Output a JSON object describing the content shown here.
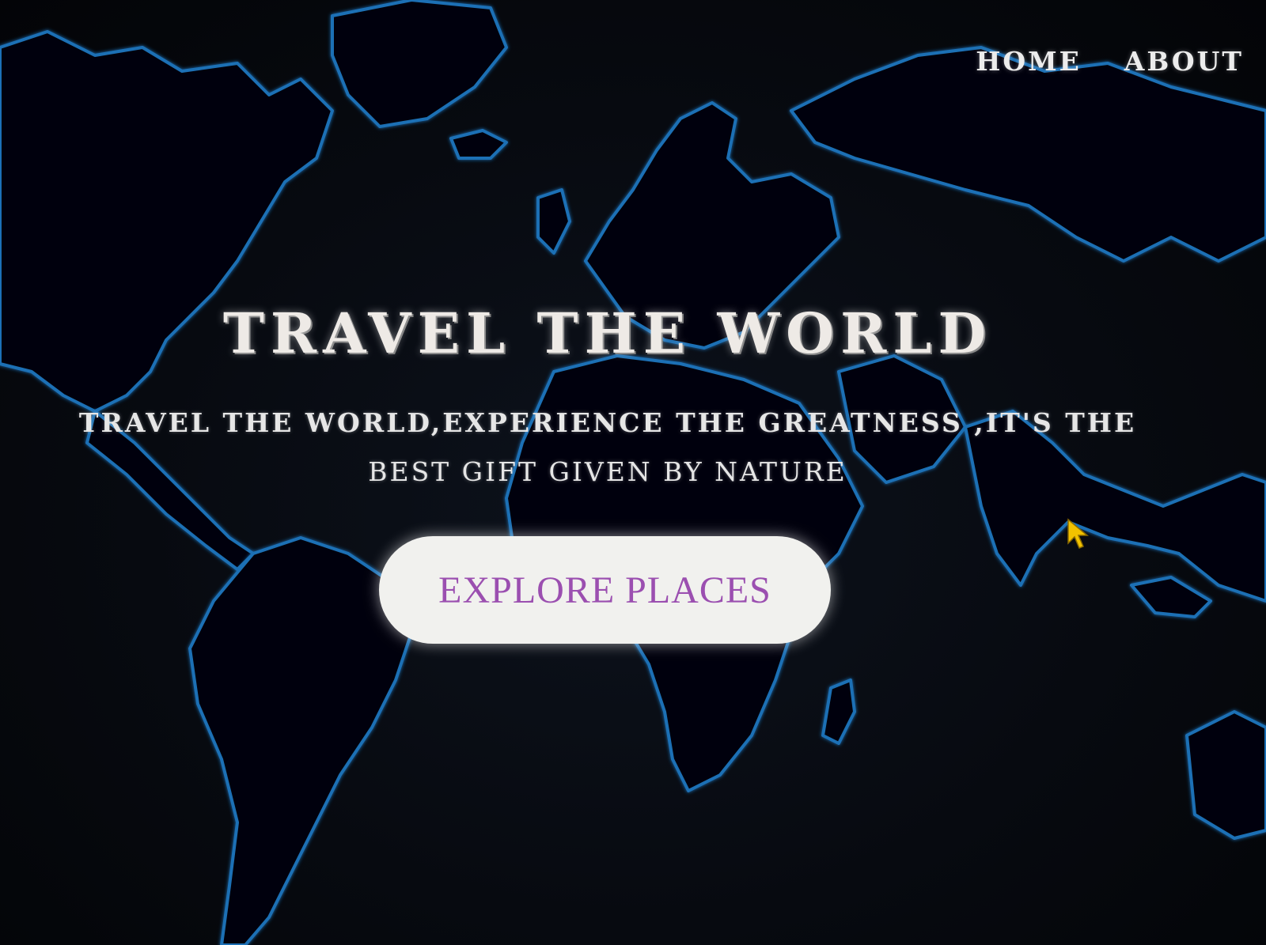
{
  "nav": {
    "items": [
      {
        "label": "HOME"
      },
      {
        "label": "ABOUT"
      }
    ]
  },
  "hero": {
    "title": "TRAVEL THE WORLD",
    "subtitle_line1": "TRAVEL THE WORLD,EXPERIENCE THE GREATNESS ,IT'S THE",
    "subtitle_line2": "BEST GIFT GIVEN BY NATURE",
    "cta_label": "EXPLORE PLACES"
  },
  "background": {
    "icon": "world-map-icon",
    "outline_color": "#1f6fb5",
    "base_color": "#05070c"
  },
  "colors": {
    "text": "#eeeae6",
    "button_bg": "#f1f1ee",
    "button_text": "#9b4fb0",
    "cursor": "#f2c200"
  },
  "cursor": {
    "icon": "mouse-pointer-icon"
  }
}
